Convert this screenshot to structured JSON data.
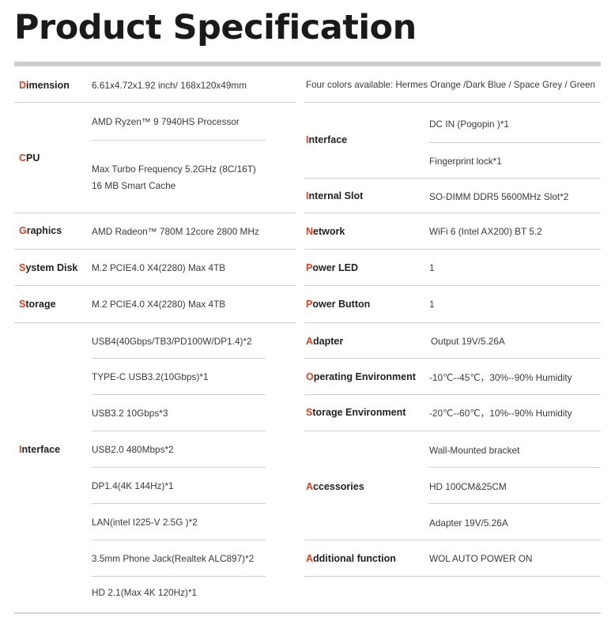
{
  "title": "Product Specification",
  "left": {
    "dimension": {
      "initial": "D",
      "rest": "imension",
      "value": "6.61x4.72x1.92 inch/ 168x120x49mm"
    },
    "cpu": {
      "initial": "C",
      "rest": "PU",
      "values": [
        "AMD Ryzen™ 9 7940HS Processor",
        "Max Turbo Frequency 5.2GHz  (8C/16T)",
        "16 MB Smart Cache"
      ]
    },
    "graphics": {
      "initial": "G",
      "rest": "raphics",
      "value": "AMD Radeon™ 780M 12core  2800 MHz"
    },
    "system_disk": {
      "initial": "S",
      "rest": "ystem Disk",
      "value": "M.2 PCIE4.0 X4(2280) Max 4TB"
    },
    "storage": {
      "initial": "S",
      "rest": "torage",
      "value": "M.2 PCIE4.0 X4(2280) Max 4TB"
    },
    "interface": {
      "initial": "I",
      "rest": "nterface",
      "values": [
        "USB4(40Gbps/TB3/PD100W/DP1.4)*2",
        "TYPE-C  USB3.2(10Gbps)*1",
        "USB3.2 10Gbps*3",
        "USB2.0  480Mbps*2",
        "DP1.4(4K 144Hz)*1",
        "LAN(intel  I225-V 2.5G )*2",
        "3.5mm Phone Jack(Realtek ALC897)*2",
        "HD 2.1(Max 4K 120Hz)*1"
      ]
    }
  },
  "right": {
    "colors": "Four colors available: Hermes Orange /Dark Blue / Space Grey / Green",
    "interface": {
      "initial": "I",
      "rest": "nterface",
      "values": [
        "DC IN (Pogopin )*1",
        "Fingerprint lock*1"
      ]
    },
    "internal_slot": {
      "initial": "I",
      "rest": "nternal Slot",
      "value": "SO-DIMM DDR5 5600MHz Slot*2"
    },
    "network": {
      "initial": "N",
      "rest": "etwork",
      "value": "WiFi 6 (Intel AX200)  BT 5.2"
    },
    "power_led": {
      "initial": "P",
      "rest": "ower LED",
      "value": "1"
    },
    "power_button": {
      "initial": "P",
      "rest": "ower Button",
      "value": "1"
    },
    "adapter": {
      "initial": "A",
      "rest": "dapter",
      "value": "Output 19V/5.26A"
    },
    "operating_env": {
      "initial": "O",
      "rest": "perating Environment",
      "value": "-10℃--45℃，30%--90% Humidity"
    },
    "storage_env": {
      "initial": "S",
      "rest": "torage Environment",
      "value": "-20℃--60℃，10%--90% Humidity"
    },
    "accessories": {
      "initial": "A",
      "rest": "ccessories",
      "values": [
        "Wall-Mounted bracket",
        "HD 100CM&25CM",
        "Adapter 19V/5.26A"
      ]
    },
    "additional": {
      "initial": "A",
      "rest": "dditional function",
      "value": "WOL   AUTO POWER ON"
    }
  },
  "colors": {
    "accent": "#e8401c",
    "rule": "#cfcfcf",
    "heading": "#1a1a1a"
  }
}
